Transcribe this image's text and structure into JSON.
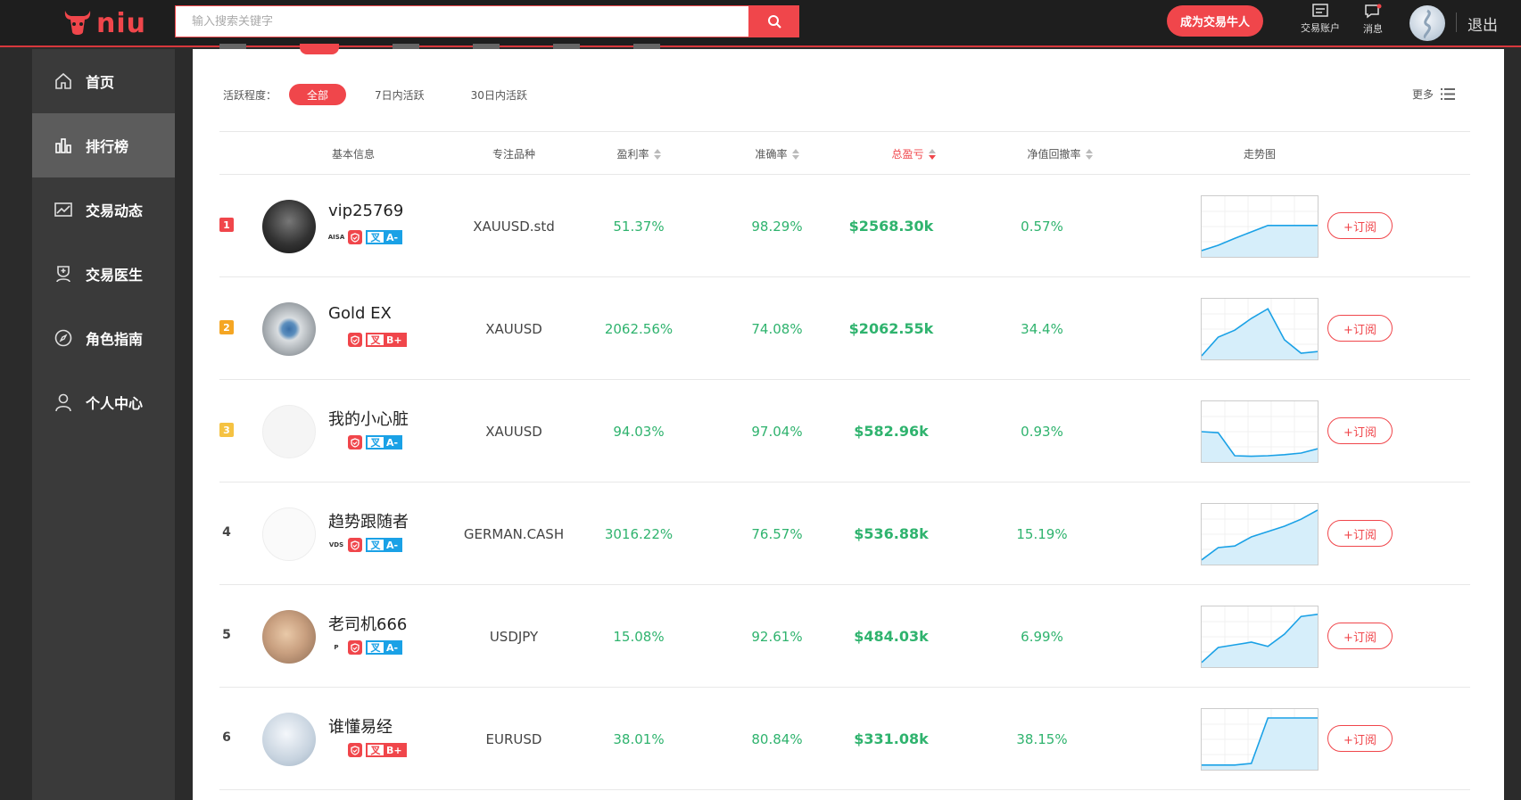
{
  "brand": {
    "logo_text": "niu",
    "accent": "#f0464b"
  },
  "search": {
    "placeholder": "输入搜索关键字"
  },
  "header": {
    "become_trader": "成为交易牛人",
    "trade_account": "交易账户",
    "messages": "消息",
    "logout": "退出"
  },
  "sidebar": {
    "items": [
      {
        "label": "首页",
        "icon": "home-icon",
        "active": false
      },
      {
        "label": "排行榜",
        "icon": "bar-chart-icon",
        "active": true
      },
      {
        "label": "交易动态",
        "icon": "trend-icon",
        "active": false
      },
      {
        "label": "交易医生",
        "icon": "doctor-icon",
        "active": false
      },
      {
        "label": "角色指南",
        "icon": "compass-icon",
        "active": false
      },
      {
        "label": "个人中心",
        "icon": "user-icon",
        "active": false
      }
    ]
  },
  "filter": {
    "label": "活跃程度：",
    "options": [
      "全部",
      "7日内活跃",
      "30日内活跃"
    ],
    "selected": "全部",
    "more": "更多"
  },
  "table": {
    "headers": {
      "basic": "基本信息",
      "symbol": "专注品种",
      "profit_rate": "盈利率",
      "accuracy": "准确率",
      "total_pnl": "总盈亏",
      "drawdown": "净值回撤率",
      "trend": "走势图"
    },
    "sorted_column": "total_pnl",
    "sort_direction": "desc",
    "subscribe_label": "+订阅",
    "rows": [
      {
        "rank": "1",
        "name": "vip25769",
        "broker": "AISA",
        "grade": "A-",
        "symbol": "XAUUSD.std",
        "profit_rate": "51.37%",
        "accuracy": "98.29%",
        "total_pnl": "$2568.30k",
        "drawdown": "0.57%",
        "trend": [
          0.05,
          0.15,
          0.28,
          0.4,
          0.52,
          0.52,
          0.52,
          0.52
        ]
      },
      {
        "rank": "2",
        "name": "Gold EX",
        "broker": "",
        "grade": "B+",
        "symbol": "XAUUSD",
        "profit_rate": "2062.56%",
        "accuracy": "74.08%",
        "total_pnl": "$2062.55k",
        "drawdown": "34.4%",
        "trend": [
          0.0,
          0.35,
          0.48,
          0.7,
          0.88,
          0.3,
          0.05,
          0.08
        ]
      },
      {
        "rank": "3",
        "name": "我的小心脏",
        "broker": "",
        "grade": "A-",
        "symbol": "XAUUSD",
        "profit_rate": "94.03%",
        "accuracy": "97.04%",
        "total_pnl": "$582.96k",
        "drawdown": "0.93%",
        "trend": [
          0.5,
          0.48,
          0.05,
          0.04,
          0.05,
          0.07,
          0.1,
          0.18
        ]
      },
      {
        "rank": "4",
        "name": "趋势跟随者",
        "broker": "VDS",
        "grade": "A-",
        "symbol": "GERMAN.CASH",
        "profit_rate": "3016.22%",
        "accuracy": "76.57%",
        "total_pnl": "$536.88k",
        "drawdown": "15.19%",
        "trend": [
          0.02,
          0.25,
          0.28,
          0.45,
          0.55,
          0.65,
          0.78,
          0.95
        ]
      },
      {
        "rank": "5",
        "name": "老司机666",
        "broker": "P",
        "grade": "A-",
        "symbol": "USDJPY",
        "profit_rate": "15.08%",
        "accuracy": "92.61%",
        "total_pnl": "$484.03k",
        "drawdown": "6.99%",
        "trend": [
          0.02,
          0.3,
          0.35,
          0.4,
          0.32,
          0.55,
          0.88,
          0.92
        ]
      },
      {
        "rank": "6",
        "name": "谁懂易经",
        "broker": "",
        "grade": "B+",
        "symbol": "EURUSD",
        "profit_rate": "38.01%",
        "accuracy": "80.84%",
        "total_pnl": "$331.08k",
        "drawdown": "38.15%",
        "trend": [
          0.02,
          0.02,
          0.02,
          0.05,
          0.9,
          0.9,
          0.9,
          0.9
        ]
      }
    ]
  }
}
